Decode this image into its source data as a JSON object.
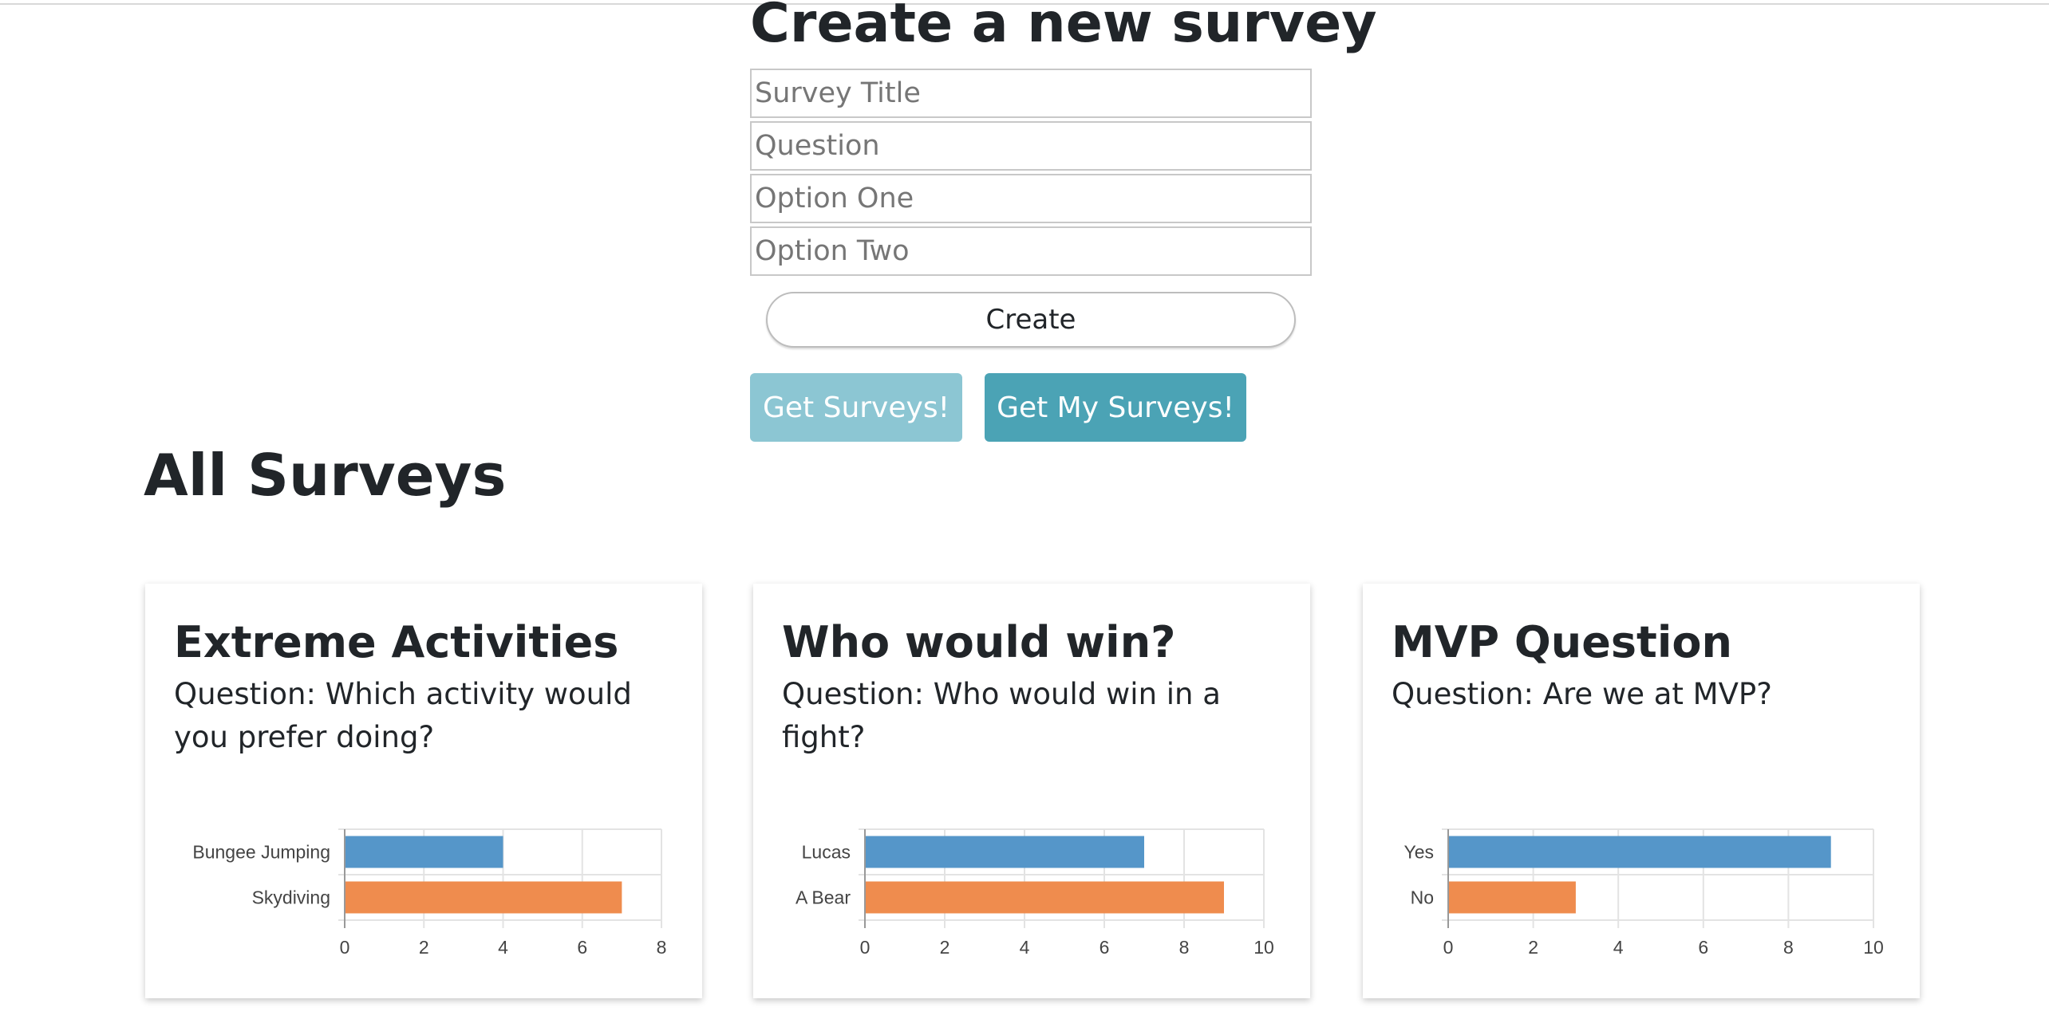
{
  "create": {
    "title": "Create a new survey",
    "survey_title_placeholder": "Survey Title",
    "question_placeholder": "Question",
    "option_one_placeholder": "Option One",
    "option_two_placeholder": "Option Two",
    "create_label": "Create"
  },
  "actions": {
    "get_surveys_label": "Get Surveys!",
    "get_my_surveys_label": "Get My Surveys!"
  },
  "list": {
    "heading": "All Surveys"
  },
  "colors": {
    "series_one": "#5596c9",
    "series_two": "#ef8c4e",
    "button_light": "#8cc6d3",
    "button_dark": "#4ba3b5"
  },
  "surveys": [
    {
      "title": "Extreme Activities",
      "question": "Question: Which activity would you prefer doing?"
    },
    {
      "title": "Who would win?",
      "question": "Question: Who would win in a fight?"
    },
    {
      "title": "MVP Question",
      "question": "Question: Are we at MVP?"
    }
  ],
  "chart_data": [
    {
      "type": "bar",
      "orientation": "horizontal",
      "categories": [
        "Bungee Jumping",
        "Skydiving"
      ],
      "values": [
        4,
        7
      ],
      "xlim": [
        0,
        8
      ],
      "xticks": [
        "0",
        "2",
        "4",
        "6",
        "8"
      ],
      "grid": true
    },
    {
      "type": "bar",
      "orientation": "horizontal",
      "categories": [
        "Lucas",
        "A Bear"
      ],
      "values": [
        7,
        9
      ],
      "xlim": [
        0,
        10
      ],
      "xticks": [
        "0",
        "2",
        "4",
        "6",
        "8",
        "10"
      ],
      "grid": true
    },
    {
      "type": "bar",
      "orientation": "horizontal",
      "categories": [
        "Yes",
        "No"
      ],
      "values": [
        9,
        3
      ],
      "xlim": [
        0,
        10
      ],
      "xticks": [
        "0",
        "2",
        "4",
        "6",
        "8",
        "10"
      ],
      "grid": true
    }
  ]
}
